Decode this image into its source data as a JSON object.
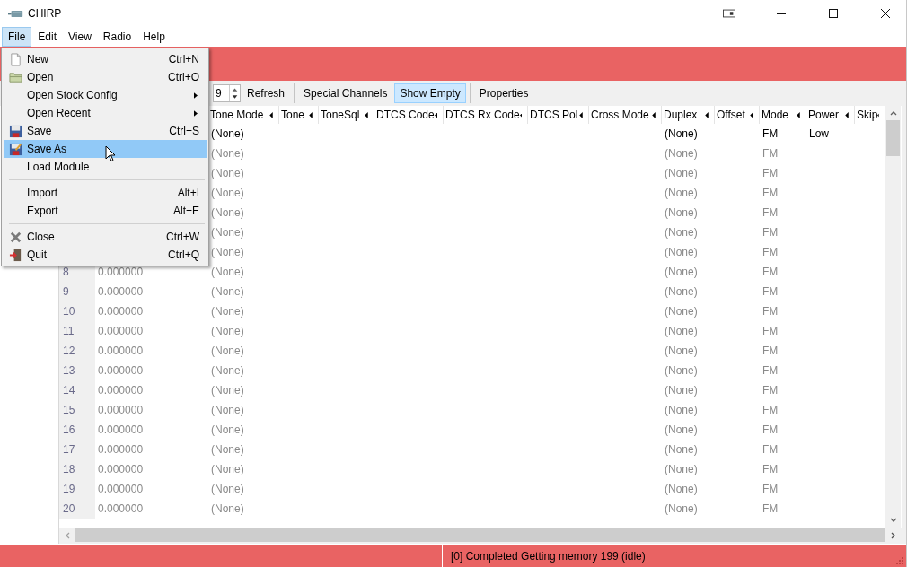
{
  "window": {
    "title": "CHIRP"
  },
  "menubar": [
    {
      "label": "File",
      "selected": true
    },
    {
      "label": "Edit",
      "selected": false
    },
    {
      "label": "View",
      "selected": false
    },
    {
      "label": "Radio",
      "selected": false
    },
    {
      "label": "Help",
      "selected": false
    }
  ],
  "file_menu": [
    {
      "kind": "item",
      "label": "New",
      "shortcut": "Ctrl+N",
      "selected": false
    },
    {
      "kind": "item",
      "label": "Open",
      "shortcut": "Ctrl+O",
      "selected": false
    },
    {
      "kind": "submenu",
      "label": "Open Stock Config",
      "selected": false
    },
    {
      "kind": "submenu",
      "label": "Open Recent",
      "selected": false
    },
    {
      "kind": "item",
      "label": "Save",
      "shortcut": "Ctrl+S",
      "selected": false
    },
    {
      "kind": "item",
      "label": "Save As",
      "selected": true
    },
    {
      "kind": "item",
      "label": "Load Module",
      "selected": false
    },
    {
      "kind": "separator"
    },
    {
      "kind": "item",
      "label": "Import",
      "shortcut": "Alt+I",
      "selected": false
    },
    {
      "kind": "item",
      "label": "Export",
      "shortcut": "Alt+E",
      "selected": false
    },
    {
      "kind": "separator"
    },
    {
      "kind": "item",
      "label": "Close",
      "shortcut": "Ctrl+W",
      "selected": false
    },
    {
      "kind": "item",
      "label": "Quit",
      "shortcut": "Ctrl+Q",
      "selected": false
    }
  ],
  "toolbar": [
    {
      "kind": "spin",
      "value": "9"
    },
    {
      "kind": "button",
      "label": "Refresh"
    },
    {
      "kind": "separator"
    },
    {
      "kind": "toggle",
      "label": "Special Channels",
      "selected": false
    },
    {
      "kind": "toggle",
      "label": "Show Empty",
      "selected": true
    },
    {
      "kind": "separator"
    },
    {
      "kind": "button",
      "label": "Properties"
    }
  ],
  "table": {
    "columns": [
      "Tone Mode",
      "Tone",
      "ToneSql",
      "DTCS Code",
      "DTCS Rx Code",
      "DTCS Pol",
      "Cross Mode",
      "Duplex",
      "Offset",
      "Mode",
      "Power",
      "Skip"
    ],
    "rows": [
      {
        "empty": false,
        "tone_mode": "(None)",
        "duplex": "(None)",
        "mode": "FM",
        "power": "Low"
      },
      {
        "empty": true,
        "tone_mode": "(None)",
        "duplex": "(None)",
        "mode": "FM"
      },
      {
        "empty": true,
        "tone_mode": "(None)",
        "duplex": "(None)",
        "mode": "FM"
      },
      {
        "empty": true,
        "tone_mode": "(None)",
        "duplex": "(None)",
        "mode": "FM"
      },
      {
        "empty": true,
        "tone_mode": "(None)",
        "duplex": "(None)",
        "mode": "FM"
      },
      {
        "empty": true,
        "tone_mode": "(None)",
        "duplex": "(None)",
        "mode": "FM"
      },
      {
        "empty": true,
        "tone_mode": "(None)",
        "duplex": "(None)",
        "mode": "FM"
      },
      {
        "empty": true,
        "loc": "8",
        "frequency": "0.000000",
        "tone_mode": "(None)",
        "duplex": "(None)",
        "mode": "FM"
      },
      {
        "empty": true,
        "loc": "9",
        "frequency": "0.000000",
        "tone_mode": "(None)",
        "duplex": "(None)",
        "mode": "FM"
      },
      {
        "empty": true,
        "loc": "10",
        "frequency": "0.000000",
        "tone_mode": "(None)",
        "duplex": "(None)",
        "mode": "FM"
      },
      {
        "empty": true,
        "loc": "11",
        "frequency": "0.000000",
        "tone_mode": "(None)",
        "duplex": "(None)",
        "mode": "FM"
      },
      {
        "empty": true,
        "loc": "12",
        "frequency": "0.000000",
        "tone_mode": "(None)",
        "duplex": "(None)",
        "mode": "FM"
      },
      {
        "empty": true,
        "loc": "13",
        "frequency": "0.000000",
        "tone_mode": "(None)",
        "duplex": "(None)",
        "mode": "FM"
      },
      {
        "empty": true,
        "loc": "14",
        "frequency": "0.000000",
        "tone_mode": "(None)",
        "duplex": "(None)",
        "mode": "FM"
      },
      {
        "empty": true,
        "loc": "15",
        "frequency": "0.000000",
        "tone_mode": "(None)",
        "duplex": "(None)",
        "mode": "FM"
      },
      {
        "empty": true,
        "loc": "16",
        "frequency": "0.000000",
        "tone_mode": "(None)",
        "duplex": "(None)",
        "mode": "FM"
      },
      {
        "empty": true,
        "loc": "17",
        "frequency": "0.000000",
        "tone_mode": "(None)",
        "duplex": "(None)",
        "mode": "FM"
      },
      {
        "empty": true,
        "loc": "18",
        "frequency": "0.000000",
        "tone_mode": "(None)",
        "duplex": "(None)",
        "mode": "FM"
      },
      {
        "empty": true,
        "loc": "19",
        "frequency": "0.000000",
        "tone_mode": "(None)",
        "duplex": "(None)",
        "mode": "FM"
      },
      {
        "empty": true,
        "loc": "20",
        "frequency": "0.000000",
        "tone_mode": "(None)",
        "duplex": "(None)",
        "mode": "FM"
      }
    ]
  },
  "status_bar": {
    "message": "[0] Completed Getting memory 199 (idle)"
  }
}
